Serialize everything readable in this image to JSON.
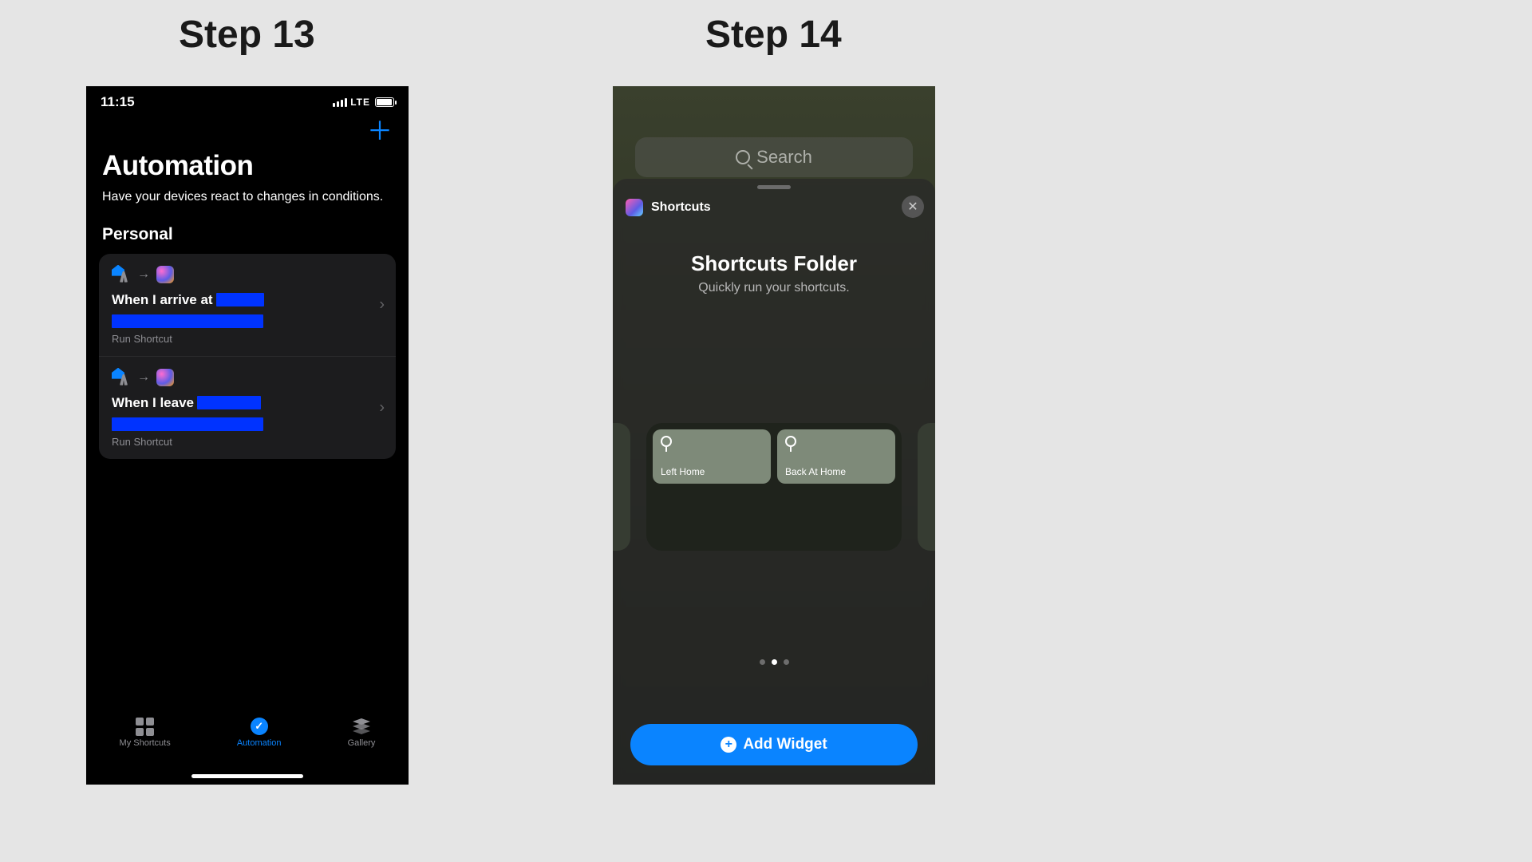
{
  "labels": {
    "step13": "Step 13",
    "step14": "Step 14"
  },
  "step13": {
    "status": {
      "time": "11:15",
      "carrier": "LTE"
    },
    "title": "Automation",
    "subtitle": "Have your devices react to changes in conditions.",
    "section": "Personal",
    "items": [
      {
        "title_prefix": "When I arrive at",
        "action": "Run Shortcut"
      },
      {
        "title_prefix": "When I leave",
        "action": "Run Shortcut"
      }
    ],
    "tabs": {
      "my": "My Shortcuts",
      "auto": "Automation",
      "gallery": "Gallery"
    }
  },
  "step14": {
    "search_placeholder": "Search",
    "app_label": "Shortcuts",
    "sheet_title": "Shortcuts Folder",
    "sheet_subtitle": "Quickly run your shortcuts.",
    "tiles": [
      {
        "label": "Left Home"
      },
      {
        "label": "Back At Home"
      }
    ],
    "page_index": 1,
    "page_count": 3,
    "add_button": "Add Widget"
  }
}
